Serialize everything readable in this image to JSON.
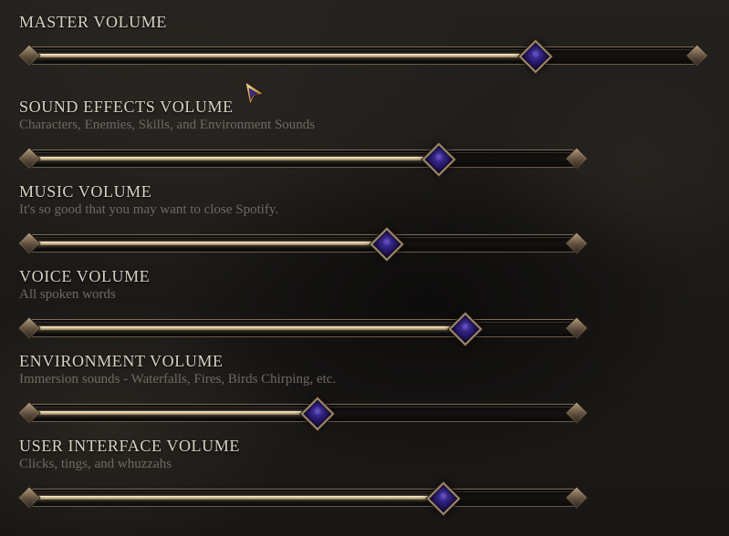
{
  "settings": [
    {
      "id": "master",
      "title": "MASTER VOLUME",
      "description": "",
      "value": 0.76
    },
    {
      "id": "sfx",
      "title": "SOUND EFFECTS VOLUME",
      "description": "Characters, Enemies, Skills, and Environment Sounds",
      "value": 0.75
    },
    {
      "id": "music",
      "title": "MUSIC VOLUME",
      "description": "It's so good that you may want to close Spotify.",
      "value": 0.655
    },
    {
      "id": "voice",
      "title": "VOICE VOLUME",
      "description": "All spoken words",
      "value": 0.8
    },
    {
      "id": "environment",
      "title": "ENVIRONMENT VOLUME",
      "description": "Immersion sounds - Waterfalls, Fires, Birds Chirping, etc.",
      "value": 0.525
    },
    {
      "id": "ui",
      "title": "USER INTERFACE VOLUME",
      "description": "Clicks, tings, and whuzzahs",
      "value": 0.76
    }
  ],
  "colors": {
    "title": "#d9d2c4",
    "description": "#6f6a62",
    "fill": "#e8d8b4",
    "handle_gem": "#2d1e78",
    "frame": "#7d6c58"
  },
  "icons": {
    "cursor": "arrow-cursor-icon",
    "handle": "diamond-gem-handle-icon",
    "end_cap": "diamond-end-cap-icon"
  }
}
